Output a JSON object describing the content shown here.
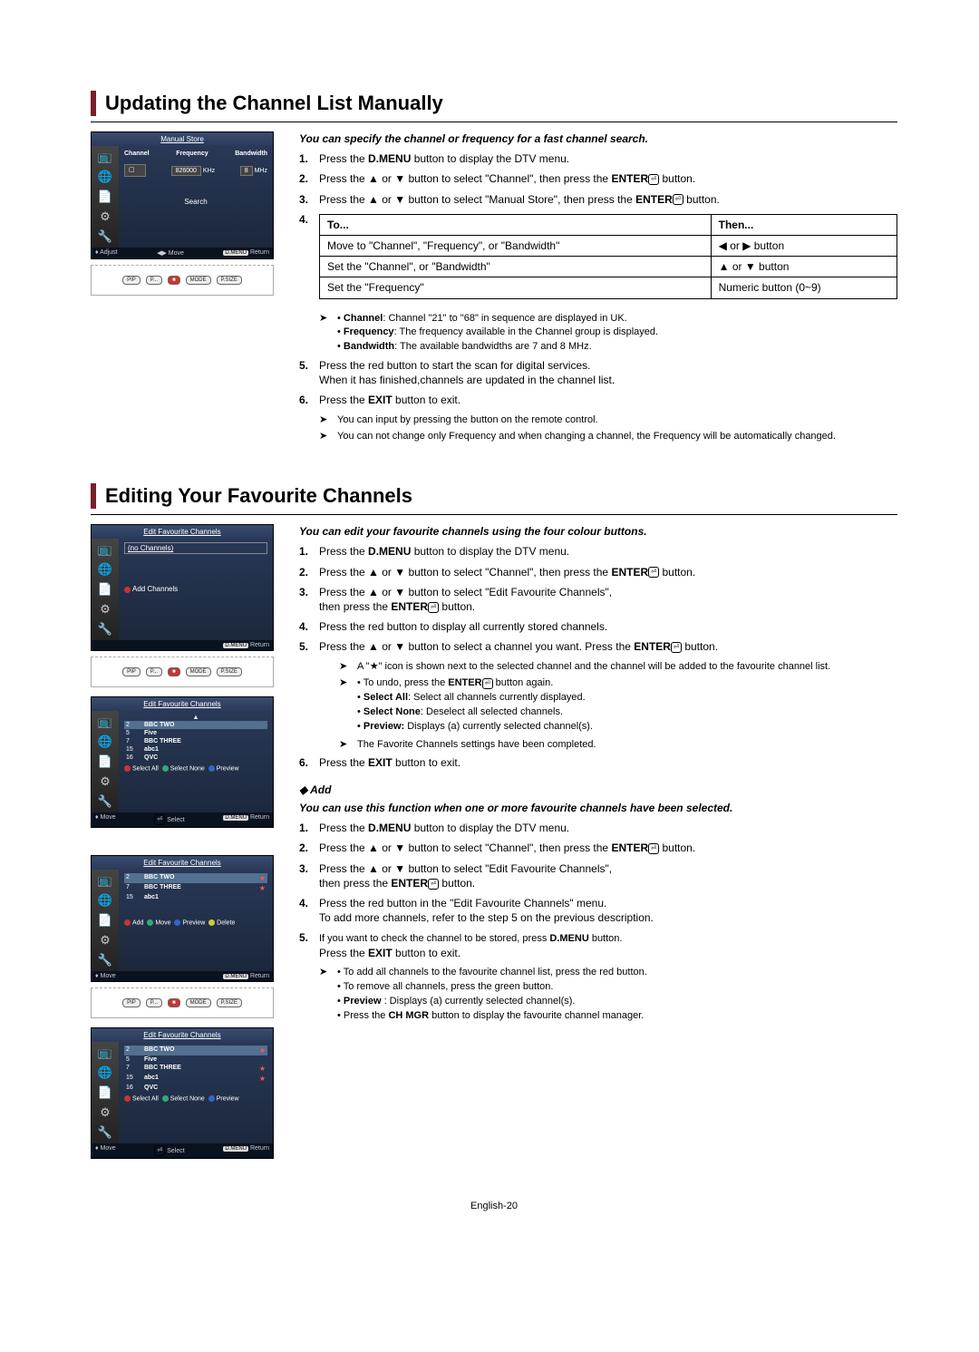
{
  "page_footer": "English-20",
  "section1": {
    "title": "Updating the Channel List Manually",
    "intro": "You can specify the channel or frequency for a fast channel search.",
    "steps": {
      "s1": "Press the D.MENU button to display the DTV menu.",
      "s2": "Press the ▲ or ▼ button to select \"Channel\", then press the ENTER button.",
      "s3": "Press the ▲ or ▼ button to select \"Manual Store\", then press the ENTER button.",
      "s5": "Press the red button to start the scan for digital services.\nWhen it has finished,channels are updated in the channel list.",
      "s6": "Press the EXIT button to exit."
    },
    "table": {
      "h_to": "To...",
      "h_then": "Then...",
      "r1_to": "Move to \"Channel\", \"Frequency\", or \"Bandwidth\"",
      "r1_then": "◀  or  ▶ button",
      "r2_to": "Set the \"Channel\", or \"Bandwidth\"",
      "r2_then": "▲  or  ▼ button",
      "r3_to": "Set the \"Frequency\"",
      "r3_then": "Numeric button (0~9)"
    },
    "notes": {
      "n1a": "Channel: Channel \"21\" to \"68\" in sequence are displayed in UK.",
      "n1b": "Frequency: The frequency available in the Channel group is displayed.",
      "n1c": "Bandwidth: The available bandwidths are 7 and 8 MHz.",
      "n2": "You can input by pressing the button on the remote control.",
      "n3": "You can not change only Frequency and when changing a channel, the Frequency will be automatically changed."
    },
    "osd": {
      "title": "Manual Store",
      "hdr_channel": "Channel",
      "hdr_freq": "Frequency",
      "hdr_bw": "Bandwidth",
      "val_freq": "826000",
      "unit_freq": "KHz",
      "val_bw": "8",
      "unit_bw": "MHz",
      "search": "Search",
      "f_adjust": "Adjust",
      "f_move": "Move",
      "f_return": "Return",
      "f_dmenu": "D.MENU"
    }
  },
  "section2": {
    "title": "Editing Your Favourite Channels",
    "intro": "You can edit your favourite channels using the four colour buttons.",
    "steps": {
      "s1": "Press the D.MENU button to display the DTV menu.",
      "s2": "Press the ▲ or ▼ button to select \"Channel\", then press the ENTER button.",
      "s3": "Press the ▲ or ▼  button to select \"Edit Favourite Channels\",\nthen press the ENTER button.",
      "s4": "Press the red button to display all currently stored channels.",
      "s5": "Press the ▲ or ▼ button to select a channel you want. Press the ENTER button.",
      "s6": "Press the EXIT button to exit."
    },
    "notes": {
      "n1": "A \"★\" icon is shown next to the selected channel and the channel will be added to the favourite channel list.",
      "n2a": "To undo, press the ENTER button again.",
      "n2b": "Select All: Select all channels currently displayed.",
      "n2c": "Select None: Deselect all selected channels.",
      "n2d": "Preview: Displays (a) currently selected channel(s).",
      "n3": "The Favorite Channels settings have been completed."
    },
    "add": {
      "heading": "Add",
      "intro": "You can use this function when one or more favourite channels have been selected.",
      "s1": "Press the D.MENU button to display the DTV menu.",
      "s2": "Press the ▲ or ▼ button to select \"Channel\", then press the ENTER button.",
      "s3": "Press the ▲ or ▼ button to select \"Edit Favourite Channels\",\nthen press the ENTER button.",
      "s4": "Press the red button in the \"Edit Favourite Channels\" menu.\nTo add more channels, refer to the step 5 on the previous description.",
      "s5a": "If you want to check the channel to be stored, press D.MENU button.",
      "s5b": "Press the EXIT button to exit.",
      "n1": "To add all channels to the favourite channel list, press the red button.",
      "n2": "To remove all channels, press the green button.",
      "n3": "Preview : Displays (a) currently selected channel(s).",
      "n4": "Press the CH MGR button to display the favourite channel manager."
    },
    "osd": {
      "title": "Edit Favourite Channels",
      "no_channels": "(no Channels)",
      "add_channels": "Add Channels",
      "f_return": "Return",
      "f_dmenu": "D.MENU",
      "f_move": "Move",
      "f_select": "Select",
      "sel_all": "Select All",
      "sel_none": "Select None",
      "preview": "Preview",
      "add": "Add",
      "move_btn": "Move",
      "delete": "Delete",
      "ch": [
        {
          "n": "2",
          "name": "BBC TWO"
        },
        {
          "n": "5",
          "name": "Five"
        },
        {
          "n": "7",
          "name": "BBC THREE"
        },
        {
          "n": "15",
          "name": "abc1"
        },
        {
          "n": "16",
          "name": "QVC"
        }
      ],
      "ch2": [
        {
          "n": "2",
          "name": "BBC TWO"
        },
        {
          "n": "7",
          "name": "BBC THREE"
        },
        {
          "n": "15",
          "name": "abc1"
        }
      ]
    },
    "remote": {
      "pip": "PIP",
      "p": "P...",
      "mode": "MODE",
      "psize": "P.SIZE"
    }
  }
}
